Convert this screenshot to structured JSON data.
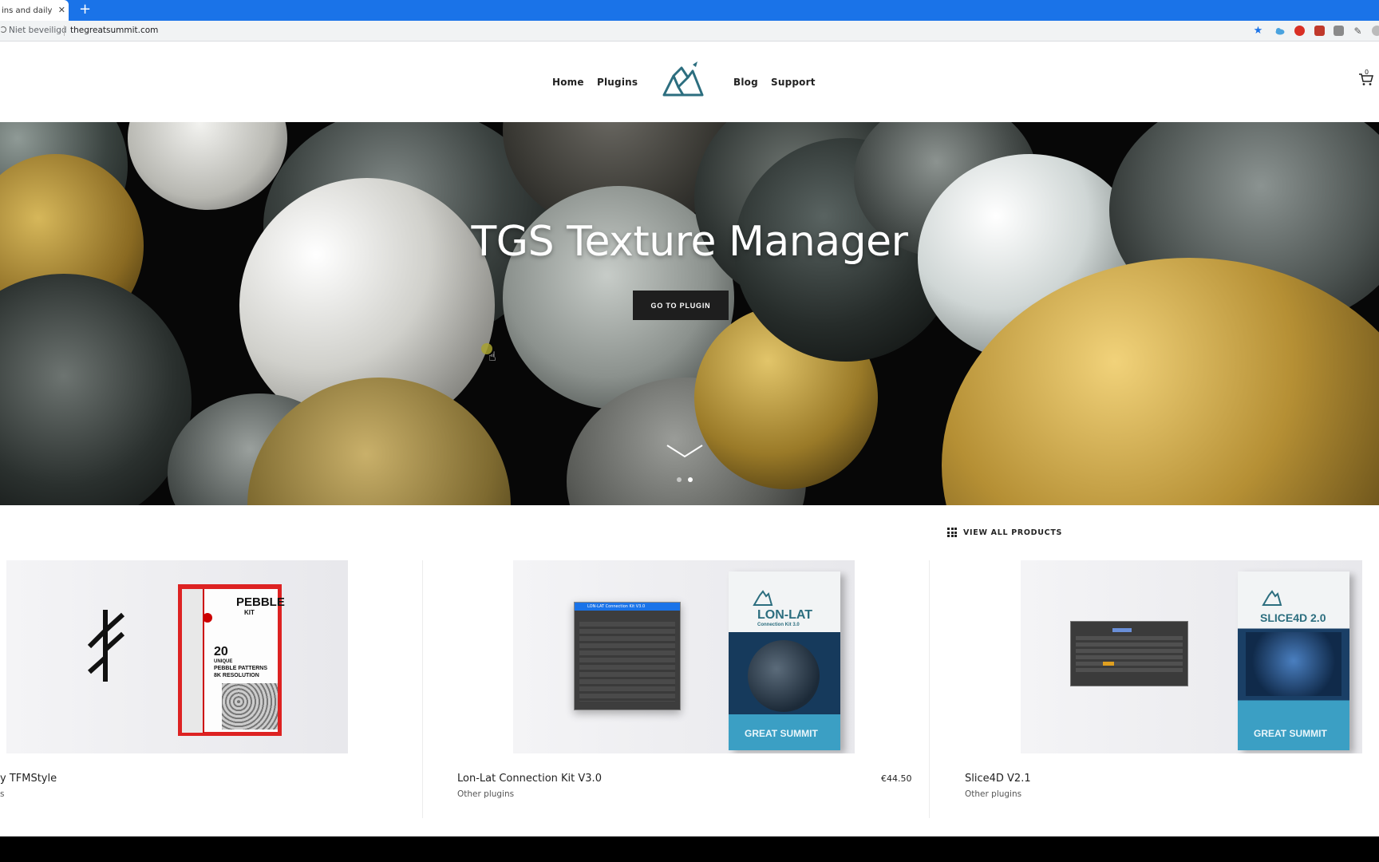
{
  "browser": {
    "tab_title": "ins and daily ma",
    "tab_close": "✕",
    "new_tab": "+",
    "security_label": "Niet beveiligd",
    "url": "thegreatsummit.com"
  },
  "nav": {
    "items": [
      "Home",
      "Plugins",
      "Blog",
      "Support"
    ],
    "cart_count": "0"
  },
  "hero": {
    "title": "TGS Texture Manager",
    "button_label": "GO TO PLUGIN"
  },
  "products": {
    "view_all_label": "VIEW ALL PRODUCTS",
    "items": [
      {
        "title": "y TFMStyle",
        "category": "s",
        "price": "",
        "box_name": "PEBBLE",
        "box_sub": "KIT",
        "box_lines": [
          "20",
          "UNIQUE",
          "PEBBLE PATTERNS",
          "8K RESOLUTION"
        ]
      },
      {
        "title": "Lon-Lat Connection Kit V3.0",
        "category": "Other plugins",
        "price": "€44.50",
        "box_name": "LON-LAT",
        "box_sub": "Connection Kit 3.0",
        "box_brand": "GREAT SUMMIT",
        "window_title": "LON-LAT Connection Kit V3.0"
      },
      {
        "title": "Slice4D V2.1",
        "category": "Other plugins",
        "price": "",
        "box_name": "SLICE4D 2.0",
        "box_brand": "GREAT SUMMIT"
      }
    ]
  },
  "colors": {
    "browser_blue": "#1a73e8",
    "hero_button": "#1e1e1e",
    "logo_teal": "#2c6e7f",
    "box_blue": "#3b9fc4"
  }
}
